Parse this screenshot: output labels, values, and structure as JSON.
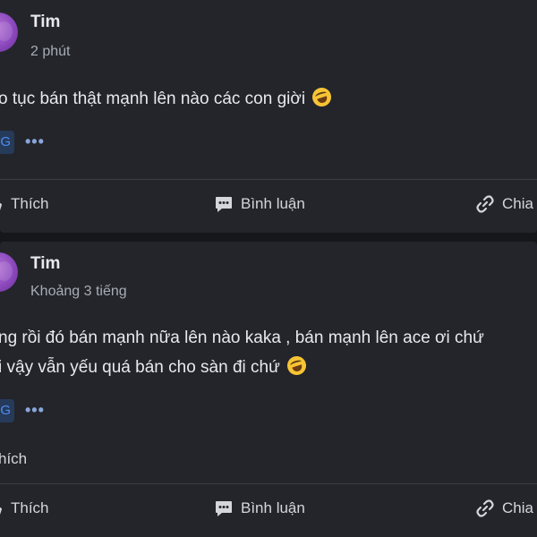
{
  "posts": [
    {
      "author": "Tim",
      "time": "2 phút",
      "lines": [
        "o tục bán thật mạnh lên nào các con giời"
      ],
      "tag": "G",
      "more": "•••",
      "actions": {
        "like": "Thích",
        "comment": "Bình luận",
        "share": "Chia"
      }
    },
    {
      "author": "Tim",
      "time": "Khoảng 3 tiếng",
      "lines": [
        "ng rồi đó bán mạnh nữa lên nào kaka , bán mạnh lên ace ơi chứ",
        "i vậy vẫn yếu quá bán cho sàn đi chứ"
      ],
      "tag": "G",
      "more": "•••",
      "likes_label": "hích",
      "actions": {
        "like": "Thích",
        "comment": "Bình luận",
        "share": "Chia"
      }
    }
  ],
  "icons": {
    "emoji": "rolling-laughing-emoji",
    "comment": "comment-bubble-icon",
    "share": "link-icon"
  }
}
